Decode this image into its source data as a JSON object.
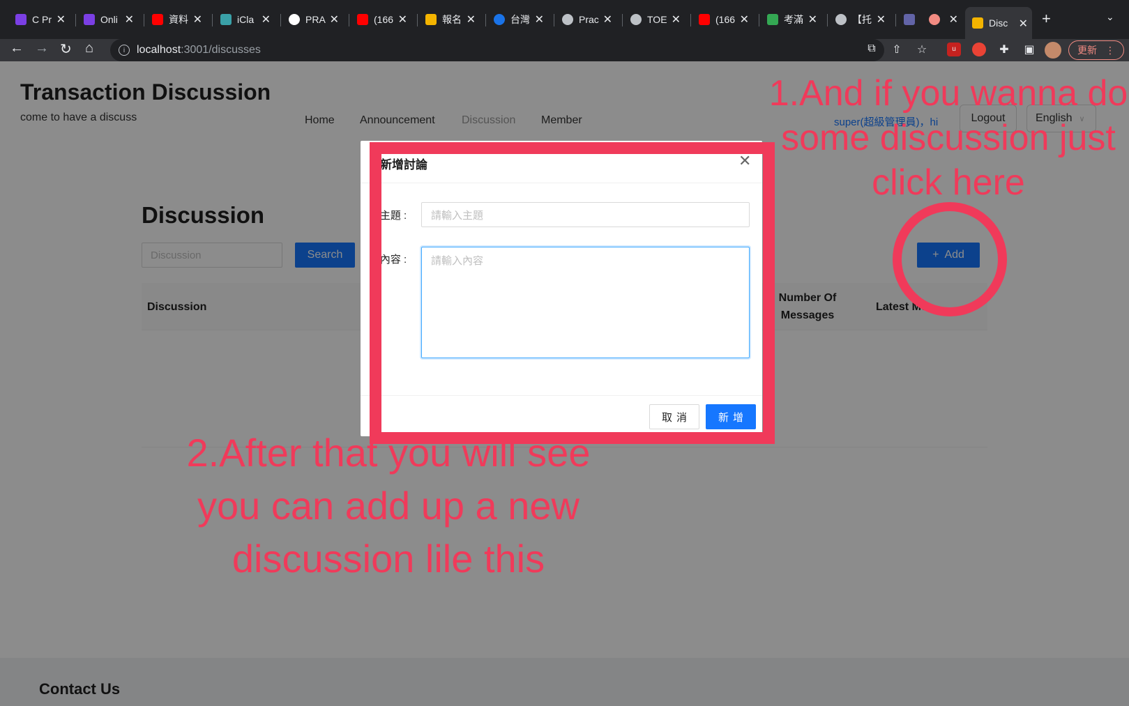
{
  "browser": {
    "tabs": [
      {
        "label": "C Pr",
        "icon": "prepare-icon",
        "color": "#7b3fe4"
      },
      {
        "label": "Onli",
        "icon": "prepare-icon",
        "color": "#7b3fe4"
      },
      {
        "label": "資料",
        "icon": "youtube-icon",
        "color": "#ff0000"
      },
      {
        "label": "iCla",
        "icon": "iclass-icon",
        "color": "#3aa1a8"
      },
      {
        "label": "PRA",
        "icon": "github-icon",
        "color": "#ffffff"
      },
      {
        "label": "(166",
        "icon": "youtube-icon",
        "color": "#ff0000"
      },
      {
        "label": "報名",
        "icon": "photo-icon",
        "color": "#f4b400"
      },
      {
        "label": "台灣",
        "icon": "taiwan-icon",
        "color": "#1a73e8"
      },
      {
        "label": "Prac",
        "icon": "ets-icon",
        "color": "#bdc1c6"
      },
      {
        "label": "TOE",
        "icon": "globe-icon",
        "color": "#bdc1c6"
      },
      {
        "label": "(166",
        "icon": "youtube-icon",
        "color": "#ff0000"
      },
      {
        "label": "考滿",
        "icon": "leaf-icon",
        "color": "#34a853"
      },
      {
        "label": "【托",
        "icon": "globe-icon",
        "color": "#bdc1c6"
      },
      {
        "label": "",
        "icon": "teams-icon",
        "color": "#6264a7"
      },
      {
        "label": "",
        "icon": "record-icon",
        "color": "#f28b82"
      },
      {
        "label": "Disc",
        "icon": "fun-icon",
        "color": "#f4b400",
        "active": true
      }
    ],
    "url_host": "localhost",
    "url_rest": ":3001/discusses",
    "update_label": "更新"
  },
  "site": {
    "title": "Transaction Discussion",
    "subtitle": "come to have a discuss",
    "nav": [
      "Home",
      "Announcement",
      "Discussion",
      "Member"
    ],
    "user": "super(超級管理員)，hi",
    "logout": "Logout",
    "language": "English"
  },
  "main": {
    "heading": "Discussion",
    "search_placeholder": "Discussion",
    "search_label": "Search",
    "add_label": "Add",
    "columns": [
      "Discussion",
      "Number Of Messages",
      "Latest Me"
    ]
  },
  "footer": {
    "title": "Contact Us"
  },
  "modal": {
    "title": "新增討論",
    "subject_label": "主題 :",
    "subject_placeholder": "請輸入主題",
    "content_label": "內容 :",
    "content_placeholder": "請輸入內容",
    "cancel_label": "取消",
    "ok_label": "新增"
  },
  "annotations": {
    "note1": "1.And if you wanna do some discussion just click here",
    "note2": "2.After that you will see you can add up a new discussion lile this"
  },
  "colors": {
    "accent": "#1677ff",
    "annotation": "#f03a5a"
  }
}
